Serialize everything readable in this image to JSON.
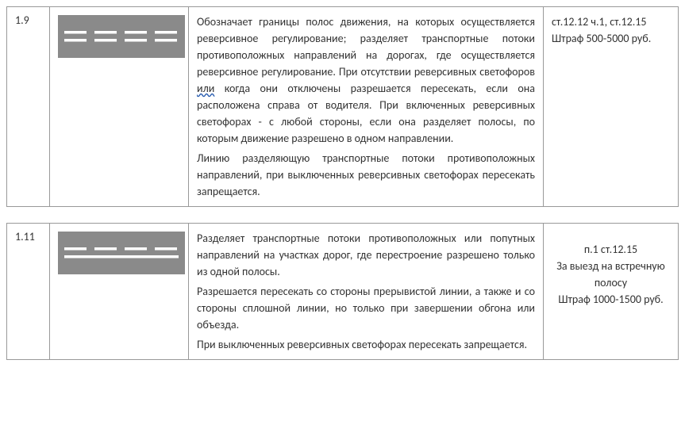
{
  "rows": [
    {
      "number": "1.9",
      "sign_type": "double-dashed",
      "description_p1_before": "Обозначает границы полос движения, на которых осуществляется реверсивное регулирование; разделяет транспортные потоки противоположных направлений на дорогах, где осуществляется реверсивное регулирование. При отсутствии реверсивных светофоров ",
      "description_p1_wavy": "или",
      "description_p1_after": " когда они отключены разрешается пересекать, если она расположена справа от водителя. При включенных реверсивных светофорах - с любой стороны, если она разделяет полосы, по которым движение разрешено в одном направлении.",
      "description_p2": "Линию разделяющую транспортные потоки противоположных направлений, при выключенных реверсивных светофорах пересекать запрещается.",
      "penalty_line1": "ст.12.12 ч.1, ст.12.15",
      "penalty_line2": "Штраф 500-5000 руб."
    },
    {
      "number": "1.11",
      "sign_type": "solid-dashed",
      "description_p1": "Разделяет транспортные потоки противоположных или попутных направлений на участках дорог, где перестроение разрешено только из одной полосы.",
      "description_p2": "Разрешается пересекать со стороны прерывистой линии, а также и со стороны сплошной линии, но только при завершении обгона или объезда.",
      "description_p3": "При выключенных реверсивных светофорах пересекать запрещается.",
      "penalty_line1": "п.1 ст.12.15",
      "penalty_line2": "За выезд на встречную полосу",
      "penalty_line3": "Штраф 1000-1500 руб."
    }
  ]
}
